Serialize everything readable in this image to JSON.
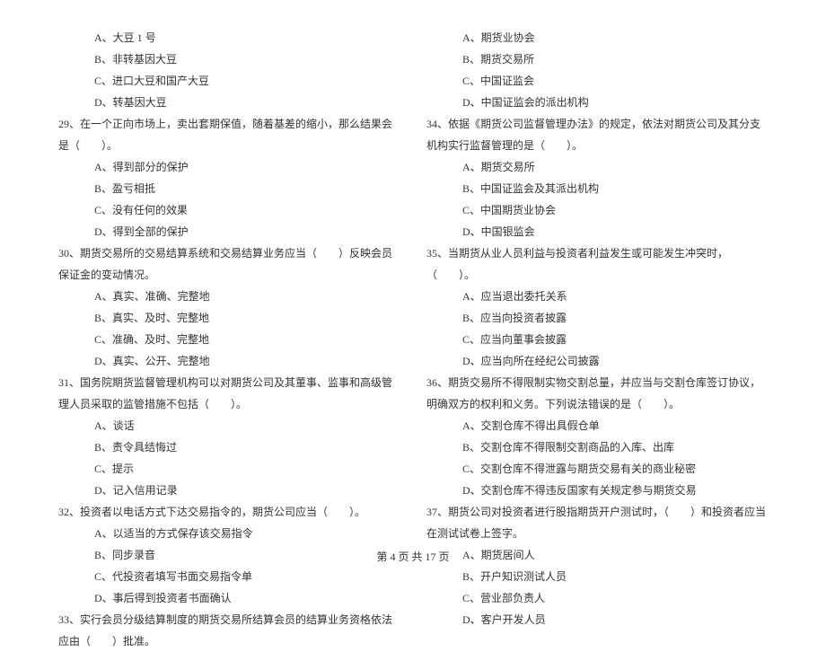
{
  "left": {
    "q28_options": {
      "a": "A、大豆 1 号",
      "b": "B、非转基因大豆",
      "c": "C、进口大豆和国产大豆",
      "d": "D、转基因大豆"
    },
    "q29": {
      "text": "29、在一个正向市场上，卖出套期保值，随着基差的缩小，那么结果会是（　　）。",
      "a": "A、得到部分的保护",
      "b": "B、盈亏相抵",
      "c": "C、没有任何的效果",
      "d": "D、得到全部的保护"
    },
    "q30": {
      "text": "30、期货交易所的交易结算系统和交易结算业务应当（　　）反映会员保证金的变动情况。",
      "a": "A、真实、准确、完整地",
      "b": "B、真实、及时、完整地",
      "c": "C、准确、及时、完整地",
      "d": "D、真实、公开、完整地"
    },
    "q31": {
      "text": "31、国务院期货监督管理机构可以对期货公司及其董事、监事和高级管理人员采取的监管措施不包括（　　）。",
      "a": "A、谈话",
      "b": "B、责令具结悔过",
      "c": "C、提示",
      "d": "D、记入信用记录"
    },
    "q32": {
      "text": "32、投资者以电话方式下达交易指令的，期货公司应当（　　）。",
      "a": "A、以适当的方式保存该交易指令",
      "b": "B、同步录音",
      "c": "C、代投资者填写书面交易指令单",
      "d": "D、事后得到投资者书面确认"
    },
    "q33": {
      "text": "33、实行会员分级结算制度的期货交易所结算会员的结算业务资格依法应由（　　）批准。"
    }
  },
  "right": {
    "q33_options": {
      "a": "A、期货业协会",
      "b": "B、期货交易所",
      "c": "C、中国证监会",
      "d": "D、中国证监会的派出机构"
    },
    "q34": {
      "text": "34、依据《期货公司监督管理办法》的规定，依法对期货公司及其分支机构实行监督管理的是（　　）。",
      "a": "A、期货交易所",
      "b": "B、中国证监会及其派出机构",
      "c": "C、中国期货业协会",
      "d": "D、中国银监会"
    },
    "q35": {
      "text": "35、当期货从业人员利益与投资者利益发生或可能发生冲突时，（　　）。",
      "a": "A、应当退出委托关系",
      "b": "B、应当向投资者披露",
      "c": "C、应当向董事会披露",
      "d": "D、应当向所在经纪公司披露"
    },
    "q36": {
      "text": "36、期货交易所不得限制实物交割总量，并应当与交割仓库签订协议，明确双方的权利和义务。下列说法错误的是（　　）。",
      "a": "A、交割仓库不得出具假仓单",
      "b": "B、交割仓库不得限制交割商品的入库、出库",
      "c": "C、交割仓库不得泄露与期货交易有关的商业秘密",
      "d": "D、交割仓库不得违反国家有关规定参与期货交易"
    },
    "q37": {
      "text": "37、期货公司对投资者进行股指期货开户测试时，（　　）和投资者应当在测试试卷上签字。",
      "a": "A、期货居间人",
      "b": "B、开户知识测试人员",
      "c": "C、营业部负责人",
      "d": "D、客户开发人员"
    }
  },
  "footer": "第 4 页 共 17 页"
}
